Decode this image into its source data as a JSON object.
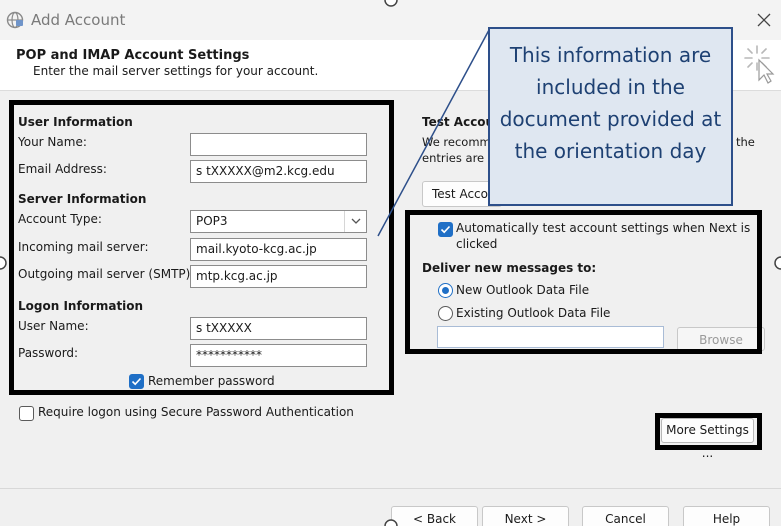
{
  "window": {
    "title": "Add Account"
  },
  "header": {
    "title": "POP and IMAP Account Settings",
    "subtitle": "Enter the mail server settings for your account."
  },
  "user_info": {
    "heading": "User Information",
    "your_name_label": "Your Name:",
    "your_name_value": "",
    "email_label": "Email Address:",
    "email_value": "s tXXXXX@m2.kcg.edu"
  },
  "server_info": {
    "heading": "Server Information",
    "account_type_label": "Account Type:",
    "account_type_value": "POP3",
    "incoming_label": "Incoming mail server:",
    "incoming_value": "mail.kyoto-kcg.ac.jp",
    "outgoing_label": "Outgoing mail server (SMTP):",
    "outgoing_value": "mtp.kcg.ac.jp"
  },
  "logon_info": {
    "heading": "Logon Information",
    "username_label": "User Name:",
    "username_value": "s tXXXXX",
    "password_label": "Password:",
    "password_value": "***********",
    "remember_label": "Remember password",
    "remember_checked": true
  },
  "spa": {
    "label": "Require logon using Secure Password Authentication",
    "checked": false
  },
  "test_settings": {
    "heading": "Test Accoun",
    "desc_line1": "We recomm",
    "desc_line2": "entries are c",
    "desc_tail": "the",
    "button_label": "Test Accou",
    "auto_test_line1": "Automatically test account settings when Next is",
    "auto_test_line2": "clicked",
    "auto_test_checked": true
  },
  "deliver": {
    "heading": "Deliver new messages to:",
    "new_file": "New Outlook Data File",
    "existing_file": "Existing Outlook Data File",
    "selected": "new",
    "browse_label": "Browse"
  },
  "more_settings_label": "More Settings ...",
  "footer": {
    "back": "< Back",
    "next": "Next >",
    "cancel": "Cancel",
    "help": "Help"
  },
  "callout": {
    "text": "This information are included in the document provided at the orientation day"
  },
  "colors": {
    "accent": "#1f6fc6",
    "callout_fill": "#dfe7f1",
    "callout_border": "#2d4f8a",
    "callout_text": "#1e4173",
    "highlight_frame": "#000000"
  }
}
